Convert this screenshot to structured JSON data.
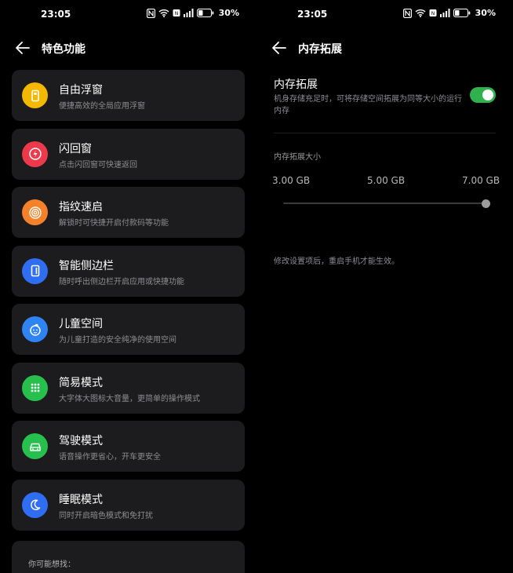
{
  "status_left": {
    "time": "23:05",
    "battery": "30%"
  },
  "status_right": {
    "time": "23:05",
    "battery": "30%"
  },
  "left": {
    "title": "特色功能",
    "items": [
      {
        "title": "自由浮窗",
        "subtitle": "便捷高效的全局应用浮窗",
        "icon": "floating-window-icon",
        "color": "#f5b800"
      },
      {
        "title": "闪回窗",
        "subtitle": "点击闪回窗可快速返回",
        "icon": "flash-back-icon",
        "color": "#ec3a4c"
      },
      {
        "title": "指纹速启",
        "subtitle": "解锁时可快捷开启付款码等功能",
        "icon": "fingerprint-icon",
        "color": "#f5822a"
      },
      {
        "title": "智能侧边栏",
        "subtitle": "随时呼出侧边栏开启应用或快捷功能",
        "icon": "sidebar-icon",
        "color": "#2f6ef2"
      },
      {
        "title": "儿童空间",
        "subtitle": "为儿童打造的安全纯净的使用空间",
        "icon": "kid-face-icon",
        "color": "#2f83f2"
      },
      {
        "title": "简易模式",
        "subtitle": "大字体大图标大音量，更简单的操作模式",
        "icon": "grid-dots-icon",
        "color": "#27c04d"
      },
      {
        "title": "驾驶模式",
        "subtitle": "语音操作更省心，开车更安全",
        "icon": "car-icon",
        "color": "#27c04d"
      },
      {
        "title": "睡眠模式",
        "subtitle": "同时开启暗色模式和免打扰",
        "icon": "moon-icon",
        "color": "#2f6ef2"
      }
    ],
    "suggest_label": "你可能想找："
  },
  "right": {
    "title": "内存拓展",
    "setting_title": "内存拓展",
    "setting_desc": "机身存储充足时，可将存储空间拓展为同等大小的运行内存",
    "toggle_on": true,
    "section_label": "内存拓展大小",
    "options": [
      "3.00 GB",
      "5.00 GB",
      "7.00 GB"
    ],
    "selected_option": "7.00 GB",
    "note": "修改设置项后，重启手机才能生效。"
  }
}
